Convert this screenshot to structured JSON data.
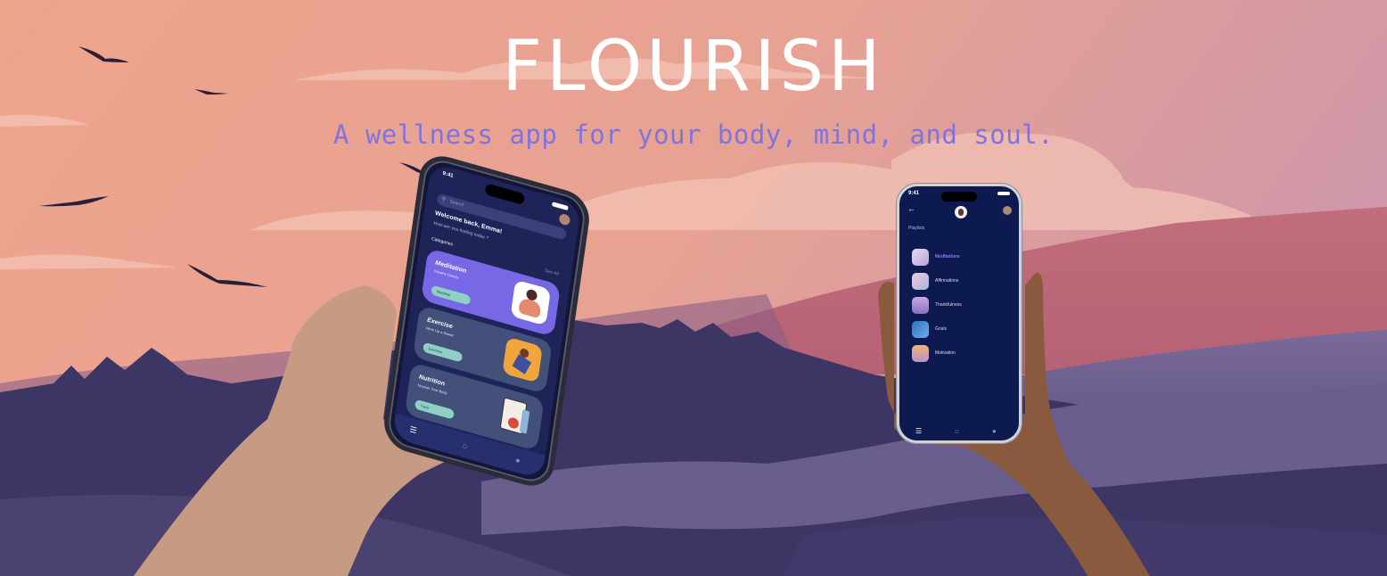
{
  "hero": {
    "title": "FLOURISH",
    "subtitle": "A wellness app for your body, mind, and soul."
  },
  "colors": {
    "sky_top": "#e6a598",
    "sky_mid": "#efa590",
    "subtitle_text": "#7f73df",
    "mountain_dark": "#3b3562",
    "mountain_mid": "#5a4f80",
    "phone_screen": "#1e2457",
    "card_meditation": "#7769e5",
    "card_exercise": "#42507a",
    "card_nutrition": "#42507a",
    "card_button": "#8fd0c2"
  },
  "phone_home": {
    "time": "9:41",
    "search_placeholder": "Search",
    "welcome": "Welcome back, Emma!",
    "prompt": "How are you feeling today ?",
    "categories_label": "Categories",
    "see_all": "See All",
    "cards": [
      {
        "title": "Meditation",
        "subtitle": "Breathe Deeply",
        "button": "Meditate",
        "icon": "meditating-person-icon"
      },
      {
        "title": "Exercise",
        "subtitle": "Work Up a Sweat",
        "button": "Exercise",
        "icon": "runner-icon"
      },
      {
        "title": "Nutrition",
        "subtitle": "Nourish Your Body",
        "button": "Track",
        "icon": "checklist-apple-icon"
      }
    ],
    "nav": [
      "playlist-icon",
      "home-icon",
      "profile-icon"
    ]
  },
  "phone_playlists": {
    "time": "9:41",
    "heading": "Playlists",
    "items": [
      {
        "label": "Meditations",
        "active": true
      },
      {
        "label": "Affirmations",
        "active": false
      },
      {
        "label": "Thankfulness",
        "active": false
      },
      {
        "label": "Goals",
        "active": false
      },
      {
        "label": "Motivation",
        "active": false
      }
    ],
    "nav": [
      "playlist-icon",
      "home-icon",
      "profile-icon"
    ]
  }
}
